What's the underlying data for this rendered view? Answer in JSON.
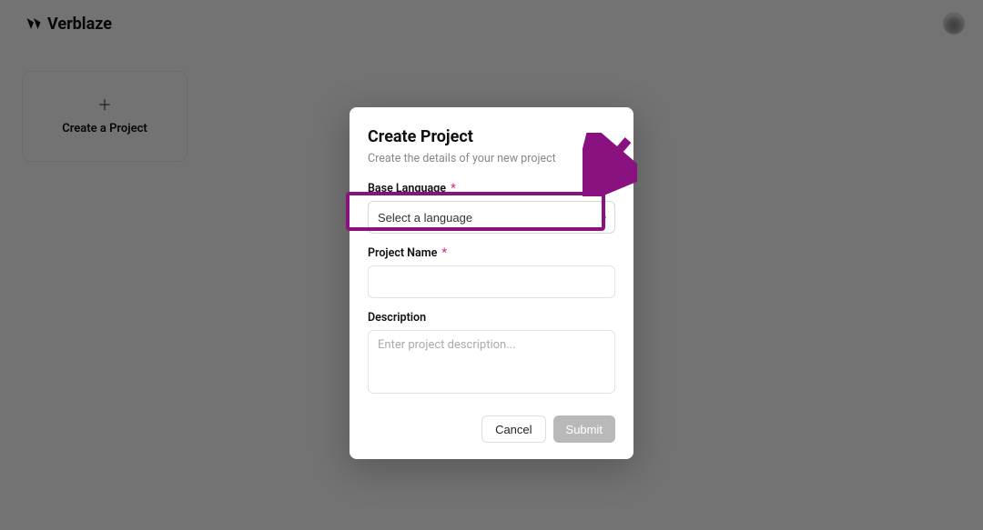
{
  "brand": {
    "name": "Verblaze"
  },
  "create_card": {
    "label": "Create a Project"
  },
  "modal": {
    "title": "Create Project",
    "subtitle": "Create the details of your new project",
    "fields": {
      "base_language": {
        "label": "Base Language",
        "required_mark": "*",
        "placeholder": "Select a language"
      },
      "project_name": {
        "label": "Project Name",
        "required_mark": "*",
        "value": ""
      },
      "description": {
        "label": "Description",
        "placeholder": "Enter project description...",
        "value": ""
      }
    },
    "actions": {
      "cancel": "Cancel",
      "submit": "Submit"
    }
  },
  "annotation": {
    "highlight_color": "#8a1180"
  }
}
